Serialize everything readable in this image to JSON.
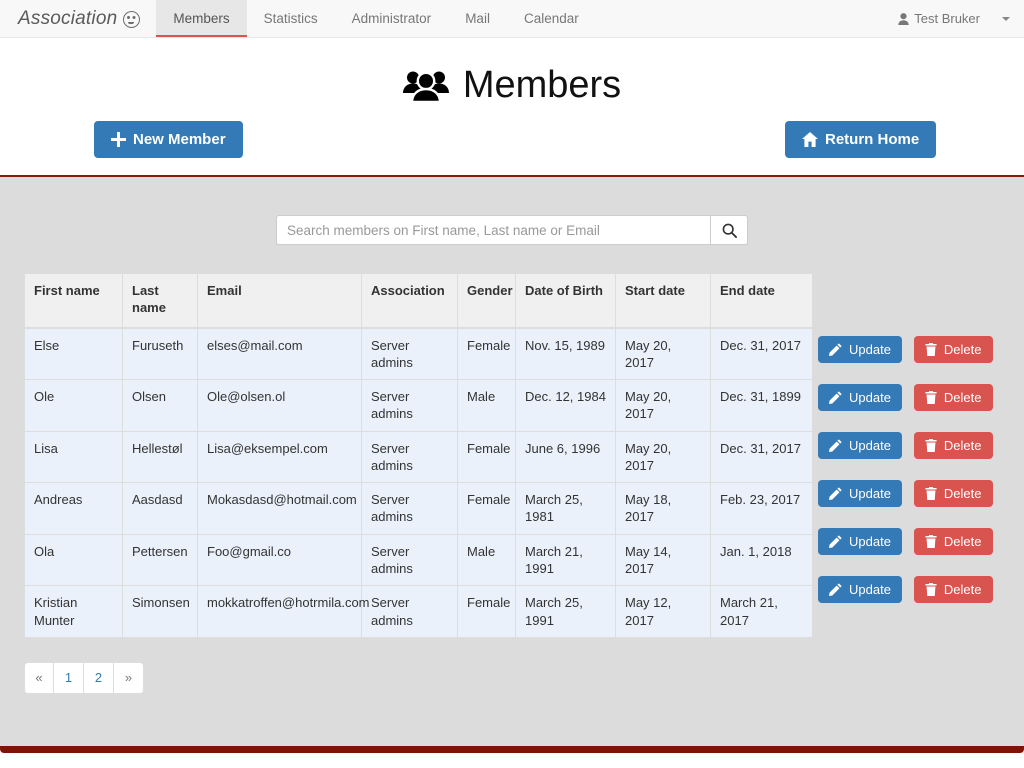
{
  "navbar": {
    "brand": "Association",
    "brand_icon": "circle-face-icon",
    "links": [
      {
        "label": "Members",
        "active": true
      },
      {
        "label": "Statistics",
        "active": false
      },
      {
        "label": "Administrator",
        "active": false
      },
      {
        "label": "Mail",
        "active": false
      },
      {
        "label": "Calendar",
        "active": false
      }
    ],
    "user": {
      "name": "Test Bruker",
      "icon": "user-icon",
      "caret": "caret-down-icon"
    }
  },
  "header": {
    "title": "Members",
    "title_icon": "users-group-icon"
  },
  "actions": {
    "new_member": {
      "label": "New Member",
      "icon": "plus-icon"
    },
    "return_home": {
      "label": "Return Home",
      "icon": "home-icon"
    }
  },
  "search": {
    "placeholder": "Search members on First name, Last name or Email",
    "value": "",
    "button_icon": "search-icon"
  },
  "table": {
    "columns": [
      "First name",
      "Last name",
      "Email",
      "Association",
      "Gender",
      "Date of Birth",
      "Start date",
      "End date"
    ],
    "rows": [
      {
        "first_name": "Else",
        "last_name": "Furuseth",
        "email": "elses@mail.com",
        "association": "Server admins",
        "gender": "Female",
        "date_of_birth": "Nov. 15, 1989",
        "start_date": "May 20, 2017",
        "end_date": "Dec. 31, 2017"
      },
      {
        "first_name": "Ole",
        "last_name": "Olsen",
        "email": "Ole@olsen.ol",
        "association": "Server admins",
        "gender": "Male",
        "date_of_birth": "Dec. 12, 1984",
        "start_date": "May 20, 2017",
        "end_date": "Dec. 31, 1899"
      },
      {
        "first_name": "Lisa",
        "last_name": "Hellestøl",
        "email": "Lisa@eksempel.com",
        "association": "Server admins",
        "gender": "Female",
        "date_of_birth": "June 6, 1996",
        "start_date": "May 20, 2017",
        "end_date": "Dec. 31, 2017"
      },
      {
        "first_name": "Andreas",
        "last_name": "Aasdasd",
        "email": "Mokasdasd@hotmail.com",
        "association": "Server admins",
        "gender": "Female",
        "date_of_birth": "March 25, 1981",
        "start_date": "May 18, 2017",
        "end_date": "Feb. 23, 2017"
      },
      {
        "first_name": "Ola",
        "last_name": "Pettersen",
        "email": "Foo@gmail.co",
        "association": "Server admins",
        "gender": "Male",
        "date_of_birth": "March 21, 1991",
        "start_date": "May 14, 2017",
        "end_date": "Jan. 1, 2018"
      },
      {
        "first_name": "Kristian Munter",
        "last_name": "Simonsen",
        "email": "mokkatroffen@hotrmila.com",
        "association": "Server admins",
        "gender": "Female",
        "date_of_birth": "March 25, 1991",
        "start_date": "May 12, 2017",
        "end_date": "March 21, 2017"
      }
    ],
    "row_actions": {
      "update": {
        "label": "Update",
        "icon": "pencil-icon"
      },
      "delete": {
        "label": "Delete",
        "icon": "trash-icon"
      }
    }
  },
  "pagination": {
    "items": [
      {
        "label": "«",
        "name": "prev"
      },
      {
        "label": "1",
        "name": "page-1"
      },
      {
        "label": "2",
        "name": "page-2"
      },
      {
        "label": "»",
        "name": "next"
      }
    ]
  },
  "colors": {
    "primary": "#337ab7",
    "danger": "#d9534f",
    "panel_bg": "#dcdcdc",
    "panel_border": "#8b1a0a",
    "table_row_bg": "#eaf1fb",
    "active_tab_underline": "#d9534f"
  }
}
